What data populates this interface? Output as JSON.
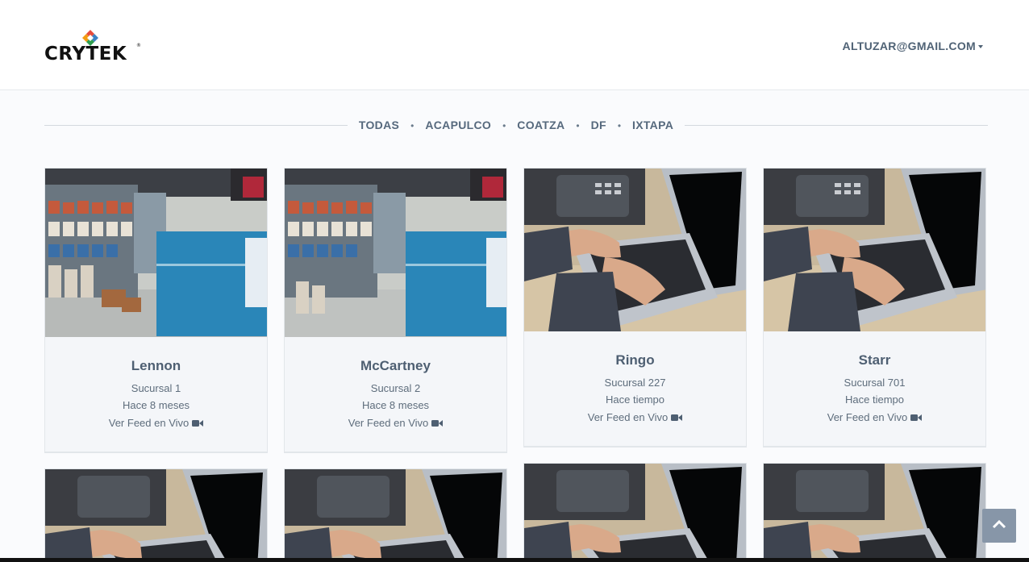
{
  "header": {
    "logo_text": "CRYTEK",
    "user_email": "ALTUZAR@GMAIL.COM"
  },
  "filters": [
    {
      "label": "TODAS"
    },
    {
      "label": "ACAPULCO"
    },
    {
      "label": "COATZA"
    },
    {
      "label": "DF"
    },
    {
      "label": "IXTAPA"
    }
  ],
  "filter_separator": "•",
  "cameras": [
    {
      "name": "Lennon",
      "branch": "Sucursal 1",
      "time": "Hace 8 meses",
      "feed_label": "Ver Feed en Vivo",
      "image": "store-interior"
    },
    {
      "name": "McCartney",
      "branch": "Sucursal 2",
      "time": "Hace 8 meses",
      "feed_label": "Ver Feed en Vivo",
      "image": "store-interior"
    },
    {
      "name": "Ringo",
      "branch": "Sucursal 227",
      "time": "Hace tiempo",
      "feed_label": "Ver Feed en Vivo",
      "image": "laptop-typing"
    },
    {
      "name": "Starr",
      "branch": "Sucursal 701",
      "time": "Hace tiempo",
      "feed_label": "Ver Feed en Vivo",
      "image": "laptop-typing"
    },
    {
      "image": "laptop-typing"
    },
    {
      "image": "laptop-typing"
    },
    {
      "image": "laptop-typing"
    },
    {
      "image": "laptop-typing"
    }
  ],
  "icons": {
    "feed": "video-camera-icon",
    "scroll_top": "chevron-up-icon",
    "user_menu": "caret-down-icon"
  },
  "colors": {
    "text": "#4e5f72",
    "card_background": "#f4f6f9",
    "scroll_button": "#8796a8"
  }
}
